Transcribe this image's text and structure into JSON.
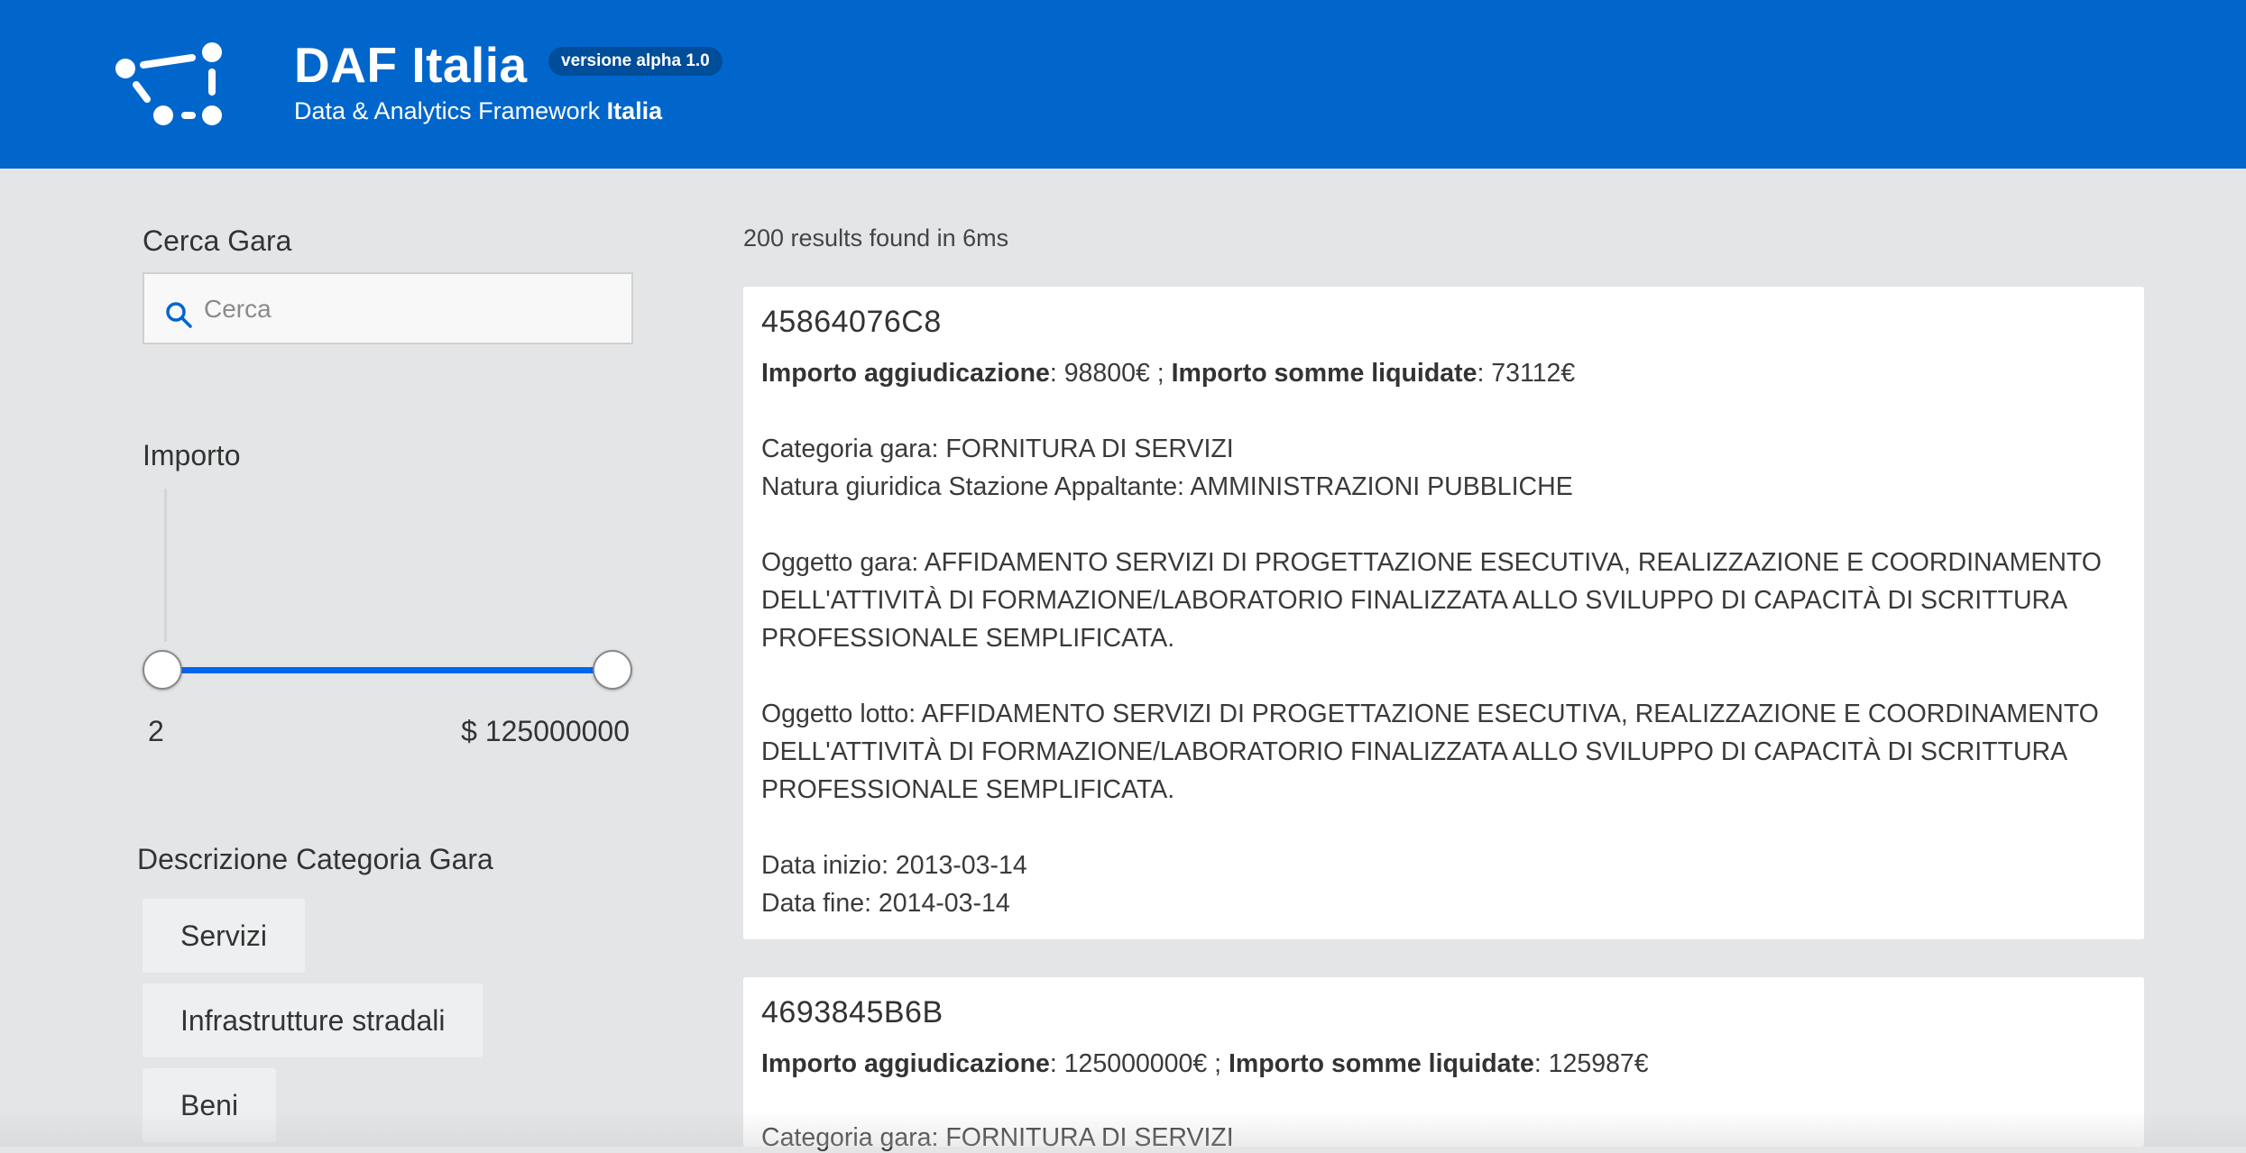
{
  "header": {
    "title": "DAF Italia",
    "version": "versione alpha 1.0",
    "subtitle_prefix": "Data & Analytics Framework",
    "subtitle_bold": "Italia",
    "brand_color": "#0066cc"
  },
  "sidebar": {
    "search_title": "Cerca Gara",
    "search_placeholder": "Cerca",
    "importo_title": "Importo",
    "range_min_label": "2",
    "range_max_label": "$ 125000000",
    "categoria_title": "Descrizione Categoria Gara",
    "categories": [
      "Servizi",
      "Infrastrutture stradali",
      "Beni"
    ]
  },
  "results": {
    "count_text": "200 results found in 6ms",
    "items": [
      {
        "id": "45864076C8",
        "importo_agg_label": "Importo aggiudicazione",
        "importo_agg_value": ": 98800€ ; ",
        "importo_liq_label": "Importo somme liquidate",
        "importo_liq_value": ": 73112€",
        "categoria": "Categoria gara: FORNITURA DI SERVIZI",
        "natura": "Natura giuridica Stazione Appaltante: AMMINISTRAZIONI PUBBLICHE",
        "oggetto_gara_1": "Oggetto gara: AFFIDAMENTO SERVIZI DI PROGETTAZIONE ESECUTIVA, REALIZZAZIONE E COORDINAMENTO",
        "oggetto_gara_2": "DELL'ATTIVITÀ DI FORMAZIONE/LABORATORIO FINALIZZATA ALLO SVILUPPO DI CAPACITÀ DI SCRITTURA",
        "oggetto_gara_3": "PROFESSIONALE SEMPLIFICATA.",
        "oggetto_lotto_1": "Oggetto lotto: AFFIDAMENTO SERVIZI DI PROGETTAZIONE ESECUTIVA, REALIZZAZIONE E COORDINAMENTO",
        "oggetto_lotto_2": "DELL'ATTIVITÀ DI FORMAZIONE/LABORATORIO FINALIZZATA ALLO SVILUPPO DI CAPACITÀ DI SCRITTURA",
        "oggetto_lotto_3": "PROFESSIONALE SEMPLIFICATA.",
        "data_inizio": "Data inizio: 2013-03-14",
        "data_fine": "Data fine: 2014-03-14"
      },
      {
        "id": "4693845B6B",
        "importo_agg_label": "Importo aggiudicazione",
        "importo_agg_value": ": 125000000€ ; ",
        "importo_liq_label": "Importo somme liquidate",
        "importo_liq_value": ": 125987€",
        "categoria": "Categoria gara: FORNITURA DI SERVIZI"
      }
    ]
  }
}
